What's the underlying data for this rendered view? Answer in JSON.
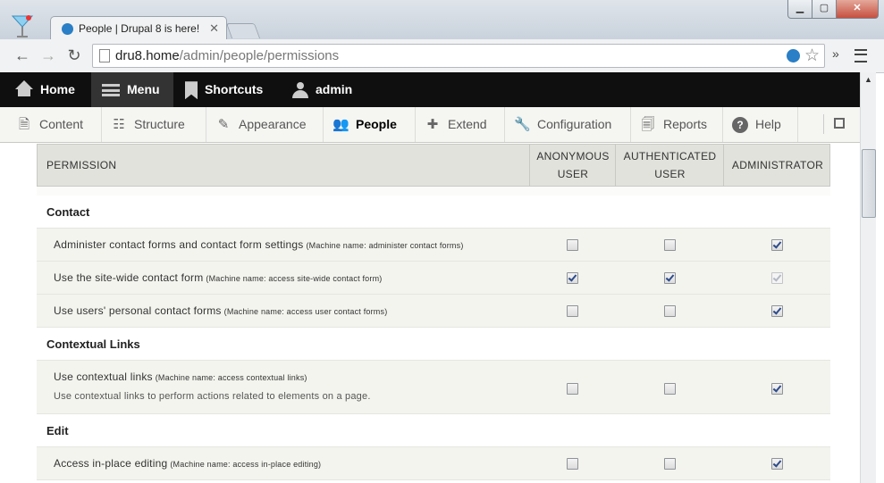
{
  "browser": {
    "tab_title": "People | Drupal 8 is here!",
    "url_host": "dru8.home",
    "url_path": "/admin/people/permissions"
  },
  "drupal_toolbar": [
    {
      "label": "Home",
      "icon": "home-icon"
    },
    {
      "label": "Menu",
      "icon": "hamburger-icon"
    },
    {
      "label": "Shortcuts",
      "icon": "bookmark-icon"
    },
    {
      "label": "admin",
      "icon": "user-icon"
    }
  ],
  "tray": [
    {
      "label": "Content",
      "icon": "document-icon"
    },
    {
      "label": "Structure",
      "icon": "sitemap-icon"
    },
    {
      "label": "Appearance",
      "icon": "paintbrush-icon"
    },
    {
      "label": "People",
      "icon": "people-icon",
      "active": true
    },
    {
      "label": "Extend",
      "icon": "puzzle-icon"
    },
    {
      "label": "Configuration",
      "icon": "wrench-icon"
    },
    {
      "label": "Reports",
      "icon": "report-icon"
    },
    {
      "label": "Help",
      "icon": "help-icon"
    }
  ],
  "table": {
    "headers": {
      "permission": "PERMISSION",
      "anonymous_1": "ANONYMOUS",
      "anonymous_2": "USER",
      "authenticated_1": "AUTHENTICATED",
      "authenticated_2": "USER",
      "administrator": "ADMINISTRATOR"
    },
    "rows": [
      {
        "type": "module",
        "label": "Contact"
      },
      {
        "type": "perm",
        "title": "Administer contact forms and contact form settings",
        "machine": "(Machine name: administer contact forms)",
        "anon": false,
        "auth": false,
        "admin": true
      },
      {
        "type": "perm",
        "title": "Use the site-wide contact form",
        "machine": "(Machine name: access site-wide contact form)",
        "anon": true,
        "auth": true,
        "admin": true,
        "admin_disabled": true
      },
      {
        "type": "perm",
        "title": "Use users' personal contact forms",
        "machine": "(Machine name: access user contact forms)",
        "anon": false,
        "auth": false,
        "admin": true
      },
      {
        "type": "module",
        "label": "Contextual Links"
      },
      {
        "type": "perm",
        "title": "Use contextual links",
        "machine": "(Machine name: access contextual links)",
        "description": "Use contextual links to perform actions related to elements on a page.",
        "anon": false,
        "auth": false,
        "admin": true
      },
      {
        "type": "module",
        "label": "Edit"
      },
      {
        "type": "perm",
        "title": "Access in-place editing",
        "machine": "(Machine name: access in-place editing)",
        "anon": false,
        "auth": false,
        "admin": true
      }
    ]
  }
}
